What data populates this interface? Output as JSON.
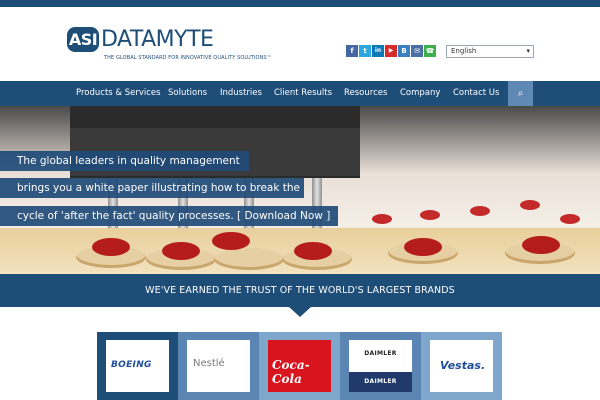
{
  "logo": {
    "badge": "ASI",
    "word": "DATAMYTE",
    "tagline": "THE GLOBAL STANDARD FOR INNOVATIVE QUALITY SOLUTIONS™"
  },
  "social": [
    {
      "icon": "facebook-icon",
      "glyph": "f",
      "color": "#4467a4"
    },
    {
      "icon": "twitter-icon",
      "glyph": "t",
      "color": "#29a9e0"
    },
    {
      "icon": "linkedin-icon",
      "glyph": "in",
      "color": "#0c7ab6"
    },
    {
      "icon": "youtube-icon",
      "glyph": "▶",
      "color": "#d52b2b"
    },
    {
      "icon": "blog-icon",
      "glyph": "B",
      "color": "#3a7fc1"
    },
    {
      "icon": "email-icon",
      "glyph": "✉",
      "color": "#4a6fa5"
    },
    {
      "icon": "phone-icon",
      "glyph": "☎",
      "color": "#3fae4c"
    }
  ],
  "language": {
    "selected": "English"
  },
  "nav": {
    "items": [
      "Products & Services",
      "Solutions",
      "Industries",
      "Client Results",
      "Resources",
      "Company",
      "Contact Us"
    ],
    "search_glyph": "⌕"
  },
  "hero": {
    "lines": [
      "The global leaders in quality management",
      "brings you a white paper illustrating how to break the",
      "cycle of 'after the fact' quality processes. [ Download Now ]"
    ]
  },
  "trust": {
    "heading": "WE'VE EARNED THE TRUST OF THE WORLD'S LARGEST BRANDS"
  },
  "brands": [
    {
      "name": "BOEING",
      "bg": "#1e4d78"
    },
    {
      "name": "Nestlé",
      "bg": "#5b86b3"
    },
    {
      "name": "Coca-Cola",
      "bg": "#7fa7cc"
    },
    {
      "name": "DAIMLER",
      "name2": "DAIMLER",
      "bg": "#5b86b3"
    },
    {
      "name": "Vestas.",
      "bg": "#7fa7cc"
    }
  ],
  "colors": {
    "brand_blue": "#1e4d78",
    "search_blue": "#5f88b4"
  }
}
